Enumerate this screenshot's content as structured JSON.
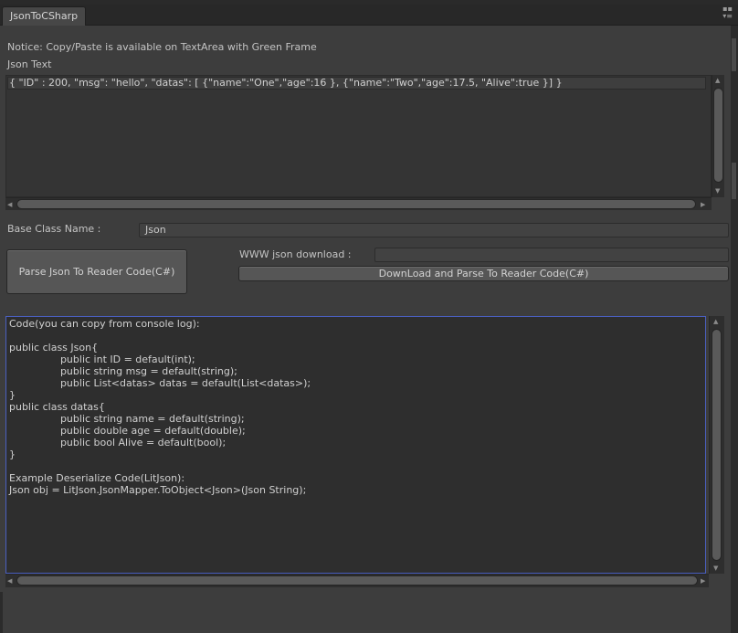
{
  "window": {
    "tab_title": "JsonToCSharp",
    "menu_glyph": "▪▪\n▾≡"
  },
  "notice": "Notice: Copy/Paste is available on TextArea with Green Frame",
  "json_section": {
    "label": "Json Text",
    "value": "{ \"ID\" : 200, \"msg\": \"hello\", \"datas\": [ {\"name\":\"One\",\"age\":16 }, {\"name\":\"Two\",\"age\":17.5, \"Alive\":true }] }"
  },
  "base_class": {
    "label": "Base Class Name :",
    "value": "Json"
  },
  "parse_button": "Parse Json To Reader Code(C#)",
  "www": {
    "label": "WWW json download :",
    "value": "",
    "button": "DownLoad and Parse To Reader Code(C#)"
  },
  "code_output": {
    "lines": [
      "Code(you can copy from console log):",
      "",
      "public class Json{",
      "                public int ID = default(int);",
      "                public string msg = default(string);",
      "                public List<datas> datas = default(List<datas>);",
      "}",
      "public class datas{",
      "                public string name = default(string);",
      "                public double age = default(double);",
      "                public bool Alive = default(bool);",
      "}",
      "",
      "Example Deserialize Code(LitJson):",
      "Json obj = LitJson.JsonMapper.ToObject<Json>(Json String);"
    ]
  },
  "scroll": {
    "left_arrow": "◀",
    "right_arrow": "▶",
    "up_arrow": "▲",
    "down_arrow": "▼"
  }
}
